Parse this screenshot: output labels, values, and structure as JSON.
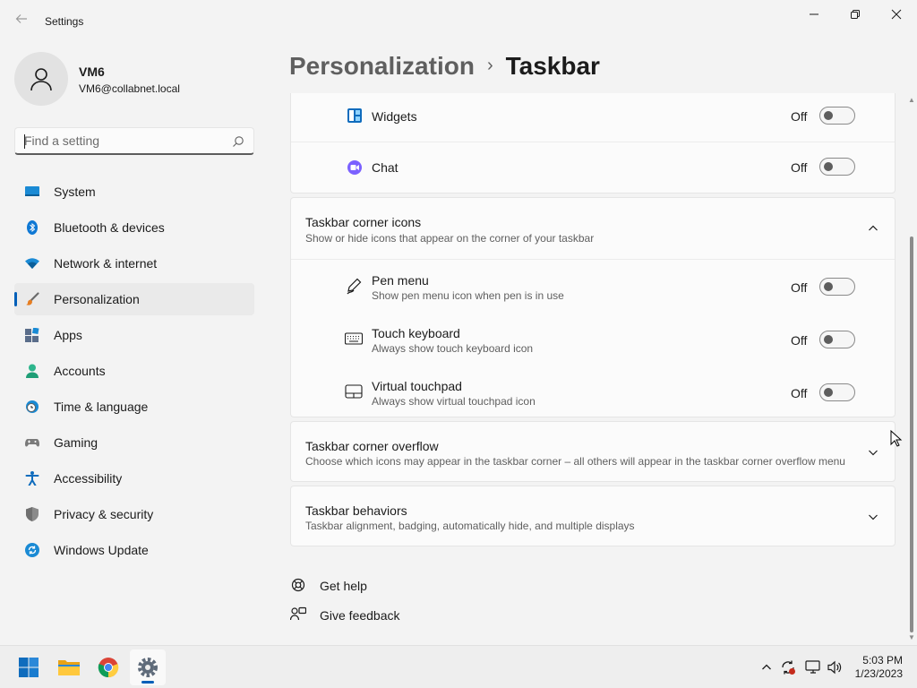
{
  "window": {
    "title": "Settings",
    "back_icon": "back-arrow-icon",
    "minimize_icon": "minimize-icon",
    "maximize_icon": "restore-icon",
    "close_icon": "close-icon"
  },
  "profile": {
    "name": "VM6",
    "email": "VM6@collabnet.local",
    "avatar_icon": "person-icon"
  },
  "search": {
    "placeholder": "Find a setting",
    "icon": "search-icon"
  },
  "nav": {
    "items": [
      {
        "label": "System",
        "icon": "system-icon"
      },
      {
        "label": "Bluetooth & devices",
        "icon": "bluetooth-icon"
      },
      {
        "label": "Network & internet",
        "icon": "wifi-icon"
      },
      {
        "label": "Personalization",
        "icon": "brush-icon",
        "selected": true
      },
      {
        "label": "Apps",
        "icon": "apps-icon"
      },
      {
        "label": "Accounts",
        "icon": "accounts-icon"
      },
      {
        "label": "Time & language",
        "icon": "clock-globe-icon"
      },
      {
        "label": "Gaming",
        "icon": "gamepad-icon"
      },
      {
        "label": "Accessibility",
        "icon": "accessibility-icon"
      },
      {
        "label": "Privacy & security",
        "icon": "shield-icon"
      },
      {
        "label": "Windows Update",
        "icon": "update-icon"
      }
    ]
  },
  "breadcrumb": {
    "parent": "Personalization",
    "separator": "›",
    "current": "Taskbar"
  },
  "taskbar_items_card": {
    "rows": [
      {
        "label": "Widgets",
        "state": "Off",
        "on": false,
        "icon": "widgets-icon"
      },
      {
        "label": "Chat",
        "state": "Off",
        "on": false,
        "icon": "chat-icon"
      }
    ]
  },
  "corner_icons": {
    "title": "Taskbar corner icons",
    "description": "Show or hide icons that appear on the corner of your taskbar",
    "expanded": true,
    "rows": [
      {
        "label": "Pen menu",
        "description": "Show pen menu icon when pen is in use",
        "state": "Off",
        "on": false,
        "icon": "pen-icon"
      },
      {
        "label": "Touch keyboard",
        "description": "Always show touch keyboard icon",
        "state": "Off",
        "on": false,
        "icon": "keyboard-icon"
      },
      {
        "label": "Virtual touchpad",
        "description": "Always show virtual touchpad icon",
        "state": "Off",
        "on": false,
        "icon": "touchpad-icon"
      }
    ]
  },
  "corner_overflow": {
    "title": "Taskbar corner overflow",
    "description": "Choose which icons may appear in the taskbar corner – all others will appear in the taskbar corner overflow menu",
    "expanded": false
  },
  "behaviors": {
    "title": "Taskbar behaviors",
    "description": "Taskbar alignment, badging, automatically hide, and multiple displays",
    "expanded": false
  },
  "help": {
    "get_help": "Get help",
    "give_feedback": "Give feedback"
  },
  "os_taskbar": {
    "apps": [
      {
        "name": "start",
        "icon": "windows-start-icon"
      },
      {
        "name": "file-explorer",
        "icon": "folder-icon"
      },
      {
        "name": "chrome",
        "icon": "chrome-icon"
      },
      {
        "name": "settings",
        "icon": "gear-icon",
        "active": true
      }
    ],
    "tray": [
      "chevron-up-icon",
      "sync-alert-icon",
      "network-icon",
      "volume-icon"
    ],
    "time": "5:03 PM",
    "date": "1/23/2023"
  },
  "colors": {
    "accent": "#005fb8",
    "background": "#f3f3f3",
    "card": "#fbfbfb"
  }
}
